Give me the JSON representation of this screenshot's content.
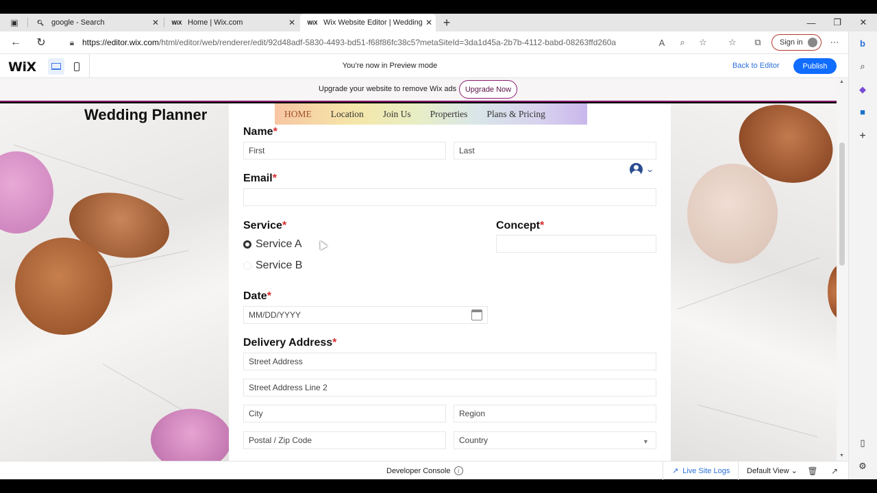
{
  "browser": {
    "tabs": [
      {
        "title": "google - Search",
        "icon": "search-icon"
      },
      {
        "title": "Home | Wix.com",
        "icon": "wix-icon"
      },
      {
        "title": "Wix Website Editor | Wedding Pl",
        "icon": "wix-icon",
        "active": true
      }
    ],
    "new_tab": "+",
    "url_host": "https://editor.wix.com",
    "url_path": "/html/editor/web/renderer/edit/92d48adf-5830-4493-bd51-f68f86fc38c5?metaSiteId=3da1d45a-2b7b-4112-babd-08263ffd260a",
    "sign_in": "Sign in"
  },
  "wix_header": {
    "logo": "WiX",
    "preview_message": "You’re now in Preview mode",
    "back_to_editor": "Back to Editor",
    "publish": "Publish"
  },
  "upgrade_banner": {
    "text": "Upgrade your website to remove Wix ads",
    "button": "Upgrade Now"
  },
  "site": {
    "title": "Wedding Planner",
    "menu": [
      "HOME",
      "Location",
      "Join Us",
      "Properties",
      "Plans & Pricing"
    ]
  },
  "form": {
    "name_label": "Name",
    "first_placeholder": "First",
    "last_placeholder": "Last",
    "email_label": "Email",
    "service_label": "Service",
    "service_options": [
      "Service A",
      "Service B"
    ],
    "concept_label": "Concept",
    "date_label": "Date",
    "date_placeholder": "MM/DD/YYYY",
    "delivery_label": "Delivery Address",
    "street_placeholder": "Street Address",
    "street2_placeholder": "Street Address Line 2",
    "city_placeholder": "City",
    "region_placeholder": "Region",
    "postal_placeholder": "Postal / Zip Code",
    "country_placeholder": "Country",
    "required_mark": "*"
  },
  "bottom_bar": {
    "developer_console": "Developer Console",
    "live_site_logs": "Live Site Logs",
    "default_view": "Default View"
  },
  "colors": {
    "accent_blue": "#116dff",
    "banner_purple": "#8a1a6e",
    "required_red": "#d62a2a"
  }
}
